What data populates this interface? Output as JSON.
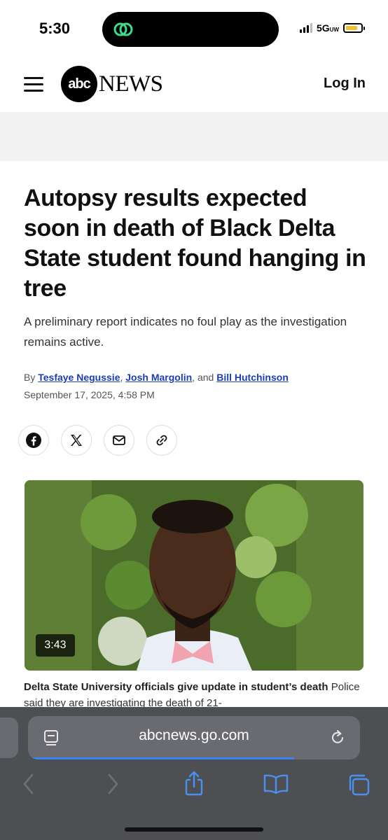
{
  "status_bar": {
    "time": "5:30",
    "network": "5G",
    "network_suffix": "UW"
  },
  "header": {
    "logo_abc": "abc",
    "logo_news": "NEWS",
    "login_label": "Log In"
  },
  "article": {
    "headline": "Autopsy results expected soon in death of Black Delta State student found hanging in tree",
    "dek": "A preliminary report indicates no foul play as the investigation remains active.",
    "byline_prefix": "By",
    "authors": [
      "Tesfaye Negussie",
      "Josh Margolin",
      "Bill Hutchinson"
    ],
    "byline_sep1": ",",
    "byline_sep2": ", and",
    "date": "September 17, 2025, 4:58 PM"
  },
  "share_icons": [
    "facebook-icon",
    "x-icon",
    "mail-icon",
    "link-icon"
  ],
  "video": {
    "duration": "3:43",
    "caption_title": "Delta State University officials give update in student’s death",
    "caption_text": "Police said they are investigating the death of 21-"
  },
  "browser": {
    "url": "abcnews.go.com"
  },
  "colors": {
    "link": "#1a3fb5",
    "toolbar": "#4e4f53",
    "accent_blue": "#3b82f6",
    "battery": "#f2c12e"
  }
}
